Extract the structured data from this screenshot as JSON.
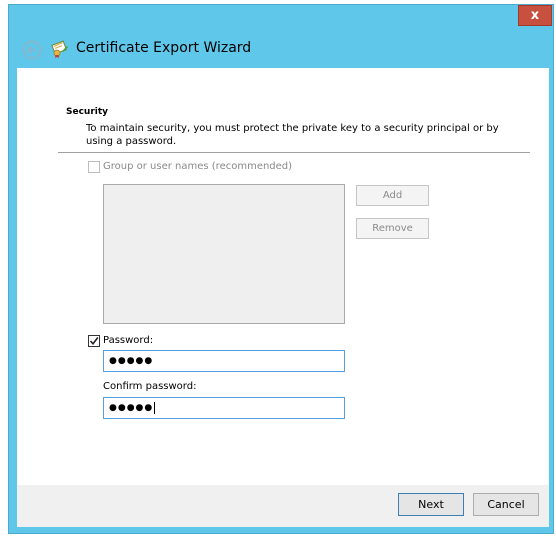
{
  "window": {
    "title": "Certificate Export Wizard",
    "close_label": "x",
    "accent_color": "#5fc7ea",
    "back_icon": "back-arrow-icon",
    "title_icon": "certificate-icon"
  },
  "security": {
    "heading": "Security",
    "description": "To maintain security, you must protect the private key to a security principal or by using a password.",
    "group_checkbox": {
      "label": "Group or user names (recommended)",
      "checked": false,
      "enabled": false
    },
    "add_button": "Add",
    "remove_button": "Remove",
    "password_checkbox": {
      "label": "Password:",
      "checked": true
    },
    "password_value": "●●●●●",
    "confirm_label": "Confirm password:",
    "confirm_value": "●●●●●"
  },
  "footer": {
    "next_button": "Next",
    "cancel_button": "Cancel"
  }
}
